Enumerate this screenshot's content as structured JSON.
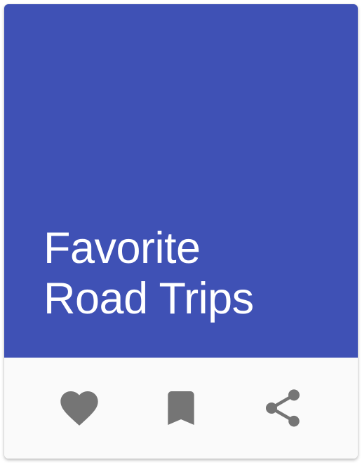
{
  "card": {
    "title_line1": "Favorite",
    "title_line2": "Road Trips",
    "media_color": "#3f51b5",
    "actions_background": "#fafafa",
    "icon_color": "#757575",
    "actions": [
      {
        "icon": "heart-icon",
        "label": "favorite"
      },
      {
        "icon": "bookmark-icon",
        "label": "bookmark"
      },
      {
        "icon": "share-icon",
        "label": "share"
      }
    ]
  }
}
